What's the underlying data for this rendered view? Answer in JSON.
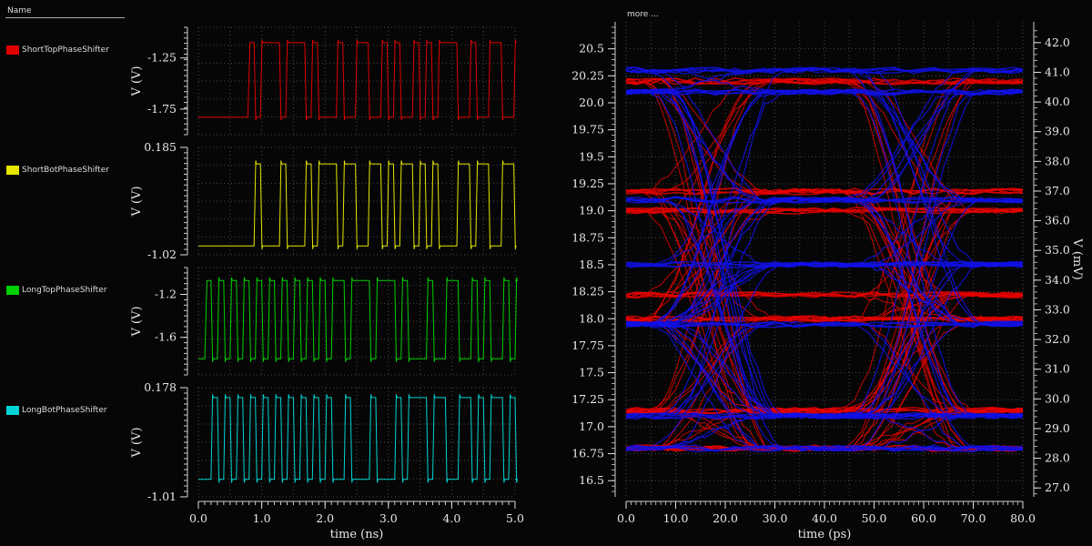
{
  "legend": {
    "header": "Name",
    "items": [
      {
        "label": "ShortTopPhaseShifter",
        "color": "#e00000"
      },
      {
        "label": "ShortBotPhaseShifter",
        "color": "#e6e600"
      },
      {
        "label": "LongTopPhaseShifter",
        "color": "#00d000"
      },
      {
        "label": "LongBotPhaseShifter",
        "color": "#00d4d4"
      }
    ]
  },
  "eye_more_label": "more ...",
  "chart_data": [
    {
      "type": "line",
      "panel": "transient",
      "series_name": "ShortTopPhaseShifter",
      "color": "#e00000",
      "ylabel": "V (V)",
      "yticks": [
        "-1.25",
        "-1.75"
      ],
      "ytick_values": [
        -1.25,
        -1.75
      ],
      "ylim": [
        -2.0,
        -0.95
      ],
      "low": -1.83,
      "high": -1.1,
      "start_ns": 0.78,
      "bit_ns": 0.1,
      "bits": "10111011101000100110010100101011100100110010101111000101101100111101"
    },
    {
      "type": "line",
      "panel": "transient",
      "series_name": "ShortBotPhaseShifter",
      "color": "#e6e600",
      "ylabel": "V (V)",
      "yticks": [
        "0.185",
        "-1.02"
      ],
      "ytick_values": [
        0.185,
        -1.02
      ],
      "ylim": [
        -1.02,
        0.185
      ],
      "low": -0.92,
      "high": 0.0,
      "start_ns": 0.78,
      "bit_ns": 0.1,
      "bits": "01000100010111011001101011010100011011001101010000111010010011000010"
    },
    {
      "type": "line",
      "panel": "transient",
      "series_name": "LongTopPhaseShifter",
      "color": "#00d000",
      "ylabel": "V (V)",
      "yticks": [
        "-1.2",
        "-1.6"
      ],
      "ytick_values": [
        -1.2,
        -1.6
      ],
      "ylim": [
        -1.95,
        -0.95
      ],
      "low": -1.8,
      "high": -1.07,
      "start_ns": 0.1,
      "bit_ns": 0.1,
      "bits": "1010101010101010101011011101110100010011001010010101110010011001010111100010110110011110101"
    },
    {
      "type": "line",
      "panel": "transient",
      "series_name": "LongBotPhaseShifter",
      "color": "#00d4d4",
      "ylabel": "V (V)",
      "yticks": [
        "0.178",
        "-1.01"
      ],
      "ytick_values": [
        0.178,
        -1.01
      ],
      "ylim": [
        -1.01,
        0.178
      ],
      "low": -0.82,
      "high": 0.07,
      "start_ns": 0.1,
      "bit_ns": 0.1,
      "bits": "0101010101010101010100100010001011101100110101101010001101100110101000011101001001100001010"
    },
    {
      "type": "line",
      "panel": "transient-xaxis",
      "xlabel": "time (ns)",
      "xlim": [
        0.0,
        5.0
      ],
      "xticks": [
        "0.0",
        "1.0",
        "2.0",
        "3.0",
        "4.0",
        "5.0"
      ],
      "xtick_values": [
        0,
        1,
        2,
        3,
        4,
        5
      ]
    },
    {
      "type": "line",
      "panel": "eye-diagram",
      "xlabel": "time (ps)",
      "xlim": [
        0.0,
        80.0
      ],
      "xticks": [
        "0.0",
        "10.0",
        "20.0",
        "30.0",
        "40.0",
        "50.0",
        "60.0",
        "70.0",
        "80.0"
      ],
      "xtick_values": [
        0,
        10,
        20,
        30,
        40,
        50,
        60,
        70,
        80
      ],
      "ylim_left": [
        16.35,
        20.75
      ],
      "yticks_left": [
        "20.5",
        "20.25",
        "20.0",
        "19.75",
        "19.5",
        "19.25",
        "19.0",
        "18.75",
        "18.5",
        "18.25",
        "18.0",
        "17.75",
        "17.5",
        "17.25",
        "17.0",
        "16.75",
        "16.5"
      ],
      "ytick_values_left": [
        20.5,
        20.25,
        20.0,
        19.75,
        19.5,
        19.25,
        19.0,
        18.75,
        18.5,
        18.25,
        18.0,
        17.75,
        17.5,
        17.25,
        17.0,
        16.75,
        16.5
      ],
      "ylabel_right": "V (mV)",
      "ylim_right": [
        26.7,
        42.7
      ],
      "yticks_right": [
        "42.0",
        "41.0",
        "40.0",
        "39.0",
        "38.0",
        "37.0",
        "36.0",
        "35.0",
        "34.0",
        "33.0",
        "32.0",
        "31.0",
        "30.0",
        "29.0",
        "28.0",
        "27.0"
      ],
      "ytick_values_right": [
        42,
        41,
        40,
        39,
        38,
        37,
        36,
        35,
        34,
        33,
        32,
        31,
        30,
        29,
        28,
        27
      ],
      "series": [
        {
          "color": "#e60000",
          "levels": [
            16.8,
            17.15,
            18.0,
            18.22,
            19.0,
            19.18,
            20.2
          ],
          "crossings": [
            16.5,
            57.0
          ]
        },
        {
          "color": "#1010e6",
          "levels": [
            16.8,
            17.1,
            17.95,
            18.5,
            19.1,
            20.1,
            20.3
          ],
          "crossings": [
            18.0,
            58.0
          ]
        }
      ]
    }
  ]
}
